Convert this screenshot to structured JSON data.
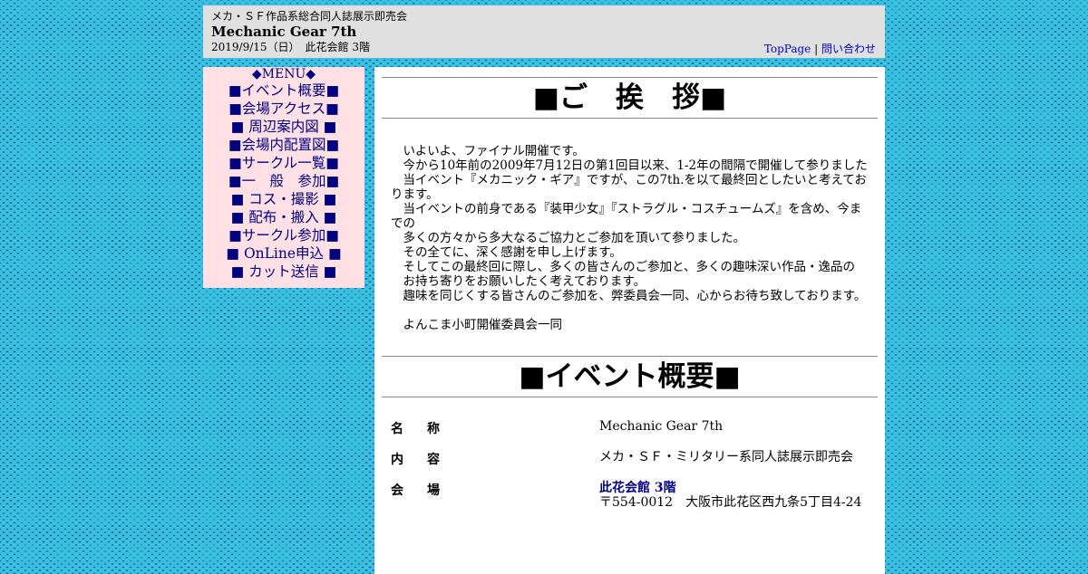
{
  "header": {
    "subtitle": "メカ・ＳＦ作品系総合同人誌展示即売会",
    "title": "Mechanic Gear 7th",
    "date_venue": "2019/9/15（日）　此花会館 3階",
    "links": {
      "top": "TopPage",
      "separator": "|",
      "contact": "問い合わせ"
    }
  },
  "menu": {
    "title": "◆MENU◆",
    "items": [
      "■イベント概要■",
      "■会場アクセス■",
      "■ 周辺案内図 ■",
      "■会場内配置図■",
      "■サークル一覧■",
      "■一　般　参加■",
      "■ コス・撮影 ■",
      "■ 配布・搬入 ■",
      "■サークル参加■",
      "■ OnLine申込 ■",
      "■ カット送信 ■"
    ]
  },
  "greeting": {
    "heading": "■ご　挨　拶■",
    "lines": [
      "　いよいよ、ファイナル開催です。",
      "　今から10年前の2009年7月12日の第1回目以来、1-2年の間隔で開催して参りました",
      "　当イベント『メカニック・ギア』ですが、この7th.を以て最終回としたいと考えております。",
      "　当イベントの前身である『装甲少女』『ストラグル・コスチュームズ』を含め、今までの",
      "　多くの方々から多大なるご協力とご参加を頂いて参りました。",
      "　その全てに、深く感謝を申し上げます。",
      "　そしてこの最終回に際し、多くの皆さんのご参加と、多くの趣味深い作品・逸品の",
      "　お持ち寄りをお願いしたく考えております。",
      "　趣味を同じくする皆さんのご参加を、弊委員会一同、心からお待ち致しております。"
    ],
    "signature": "　よんこま小町開催委員会一同"
  },
  "event": {
    "heading": "■イベント概要■",
    "rows": [
      {
        "label": "名称",
        "value": "Mechanic Gear 7th"
      },
      {
        "label": "内容",
        "value": "メカ・ＳＦ・ミリタリー系同人誌展示即売会"
      },
      {
        "label": "会場",
        "venue": "此花会館 3階",
        "address": "〒554-0012　大阪市此花区西九条5丁目4-24"
      }
    ]
  }
}
